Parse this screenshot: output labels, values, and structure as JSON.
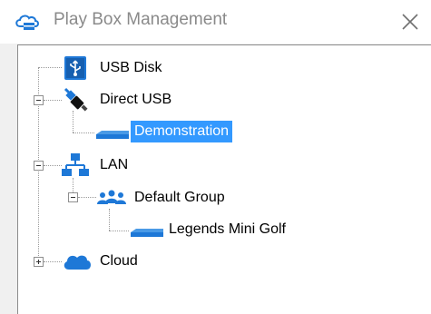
{
  "window": {
    "title": "Play Box Management"
  },
  "tree": {
    "usb_disk": "USB Disk",
    "direct_usb": "Direct USB",
    "demonstration": "Demonstration",
    "lan": "LAN",
    "default_group": "Default Group",
    "legends_mini_golf": "Legends Mini Golf",
    "cloud": "Cloud"
  },
  "colors": {
    "accent": "#3399ff",
    "icon_blue": "#1e78d7"
  },
  "icons": {
    "app": "cloud-box-icon",
    "close": "close-icon",
    "usb_disk": "usb-drive-icon",
    "direct_usb": "usb-cable-icon",
    "device": "play-box-device-icon",
    "lan": "network-icon",
    "group": "users-group-icon",
    "cloud": "cloud-icon"
  }
}
